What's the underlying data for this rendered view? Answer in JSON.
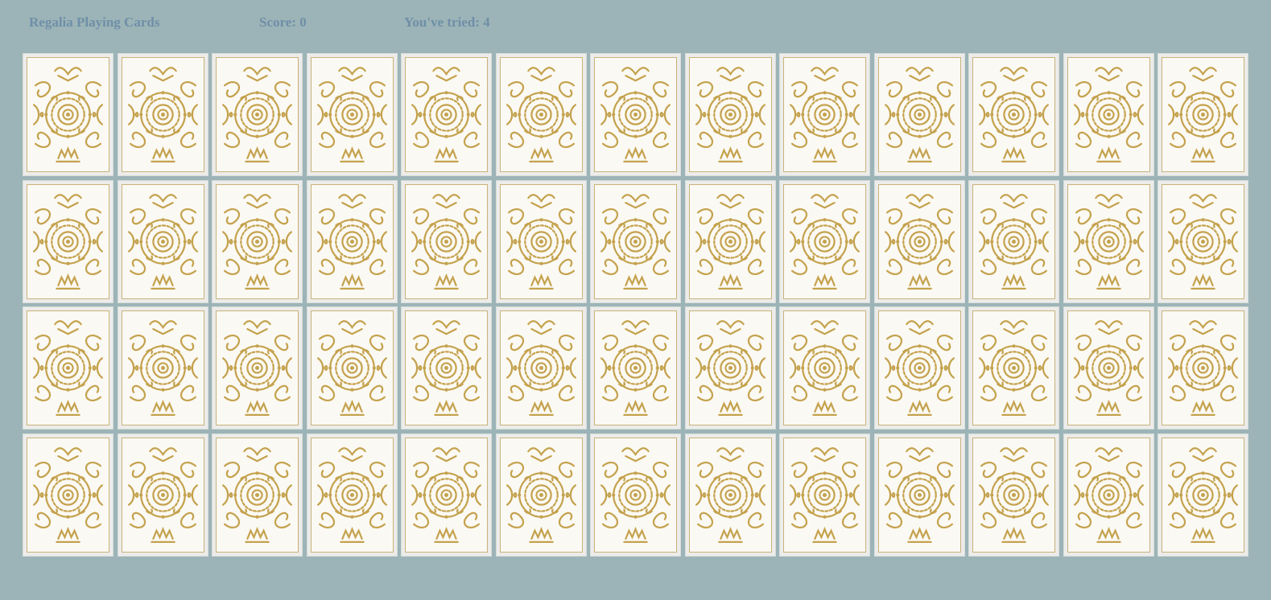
{
  "header": {
    "title": "Regalia Playing Cards",
    "score": "Score: 0",
    "tries": "You've tried: 4"
  },
  "board": {
    "rows": 4,
    "columns": 13,
    "card_state": "face-down",
    "card_back_icon": "ornamental-card-back-icon"
  },
  "colors": {
    "background": "#9cb4b7",
    "header_text": "#6f8fa8",
    "card_gold": "#c4a24e",
    "card_paper": "#fbf9f3"
  }
}
